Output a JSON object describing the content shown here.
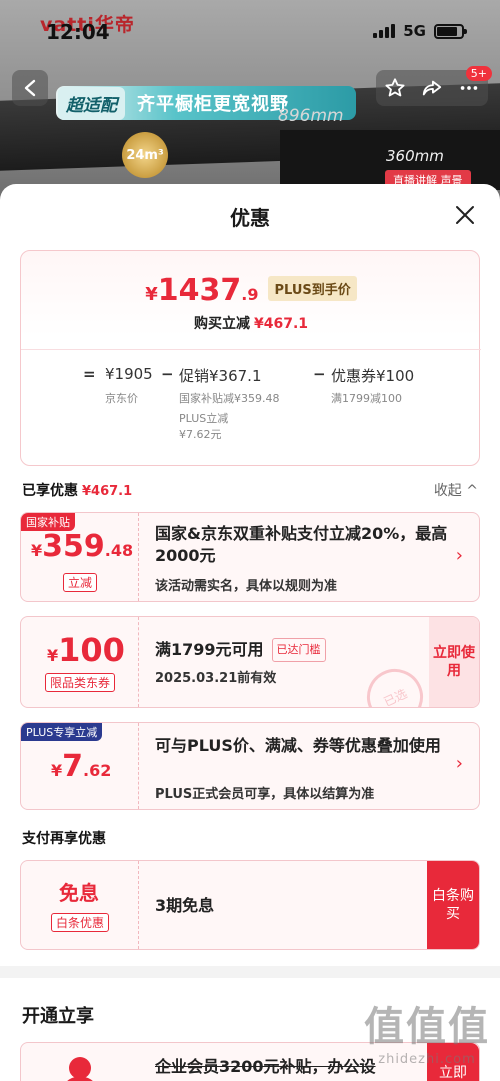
{
  "backdrop": {
    "brand": "vatti华帝",
    "pill_a": "超适配",
    "pill_b": "齐平橱柜更宽视野",
    "dim1": "896mm",
    "dim2": "360mm",
    "badge": "24m³",
    "live": "直播讲解 声景"
  },
  "status_bar": {
    "time": "12:04",
    "network": "5G",
    "battery_level": 0.85
  },
  "nav": {
    "back_icon": "chevron-left-icon",
    "cart_count": "5+"
  },
  "sheet": {
    "title": "优惠"
  },
  "price_card": {
    "currency": "¥",
    "price_int": "1437",
    "price_dec": ".9",
    "plus_tag": "PLUS到手价",
    "save_label": "购买立减",
    "save_amount": "¥467.1",
    "eq": "=",
    "jd_price": "¥1905",
    "jd_price_label": "京东价",
    "minus1": "−",
    "promo_total": "促销¥367.1",
    "promo_line1": "国家补贴减¥359.48",
    "promo_line2": "PLUS立减",
    "promo_line3": "¥7.62元",
    "minus2": "−",
    "coupon_total": "优惠券¥100",
    "coupon_line1": "满1799减100"
  },
  "enjoyed": {
    "label": "已享优惠",
    "amount": "¥467.1",
    "collapse": "收起 ^"
  },
  "promos": [
    {
      "corner": "国家补贴",
      "currency": "¥",
      "amt_int": "359",
      "amt_dec": ".48",
      "tag": "立减",
      "title": "国家&京东双重补贴支付立减20%，最高2000元",
      "sub": "该活动需实名，具体以规则为准"
    },
    {
      "currency": "¥",
      "amt_int": "100",
      "tag": "限品类东券",
      "title": "满1799元可用",
      "reach": "已达门槛",
      "sub": "2025.03.21前有效",
      "button": "立即使用",
      "stamp": "已选"
    },
    {
      "corner": "PLUS专享立减",
      "currency": "¥",
      "amt_int": "7",
      "amt_dec": ".62",
      "title": "可与PLUS价、满减、券等优惠叠加使用",
      "sub": "PLUS正式会员可享，具体以结算为准"
    }
  ],
  "pay_section": {
    "label": "支付再享优惠",
    "big": "免息",
    "tag": "白条优惠",
    "text": "3期免息",
    "button": "白条购买"
  },
  "open_section": {
    "label": "开通立享",
    "text": "企业会员3200元补贴，办公设",
    "button": "立即"
  },
  "watermark": {
    "logo": "值值值",
    "url": "zhidezhi.com"
  }
}
